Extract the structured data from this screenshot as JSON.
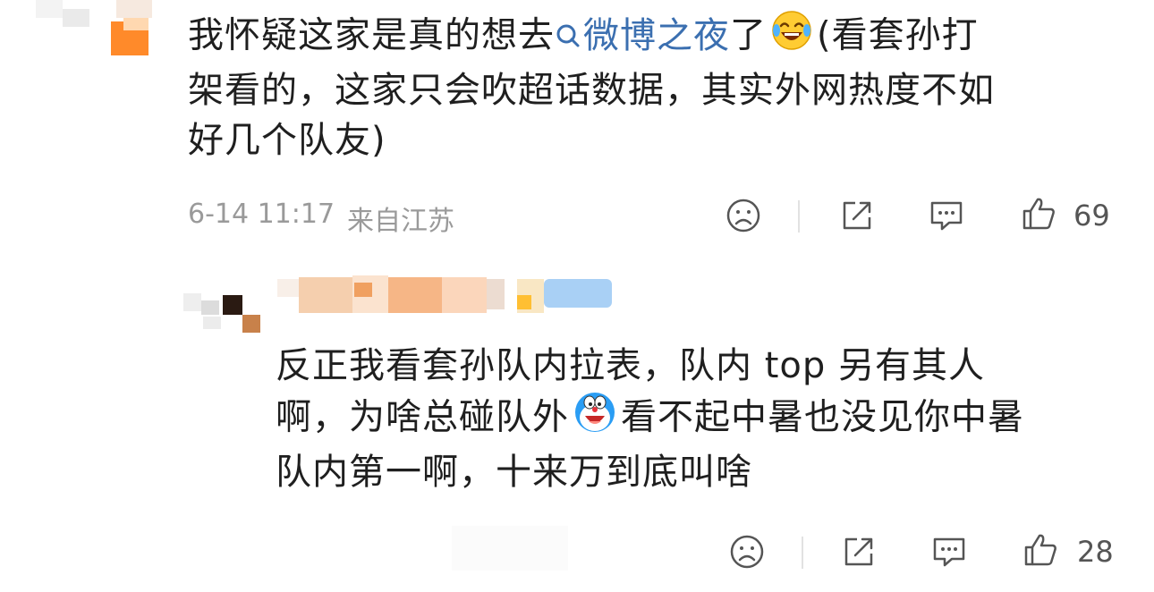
{
  "comment": {
    "text_before_topic": "我怀疑这家是真的想去",
    "topic": "微博之夜",
    "text_line1_after_topic": "了",
    "text_line1_end": "(看套孙打",
    "text_line2": "架看的，这家只会吹超话数据，其实外网热度不如",
    "text_line3": "好几个队友)",
    "date": "6-14 11:17",
    "location": "来自江苏",
    "like_count": "69"
  },
  "reply": {
    "line1": "反正我看套孙队内拉表，队内 top 另有其人",
    "line2_before_emoji": "啊，为啥总碰队外",
    "line2_after_emoji": "看不起中暑也没见你中暑",
    "line3": "队内第一啊，十来万到底叫啥",
    "like_count": "28"
  },
  "icons": {
    "dislike": "frown-face-icon",
    "share": "share-icon",
    "reply": "comment-bubble-icon",
    "like": "thumbs-up-icon",
    "topic_search": "search-icon",
    "emoji_laugh": "laughing-tears-emoji",
    "emoji_doraemon": "doraemon-emoji"
  },
  "colors": {
    "topic_link": "#3b6fb0",
    "meta_text": "#9a9a9a"
  }
}
